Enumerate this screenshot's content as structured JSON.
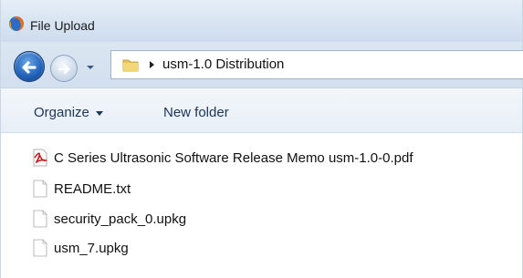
{
  "window": {
    "title": "File Upload"
  },
  "address": {
    "path_label": "usm-1.0 Distribution"
  },
  "toolbar": {
    "organize_label": "Organize",
    "new_folder_label": "New folder"
  },
  "files": [
    {
      "name": "C Series Ultrasonic Software Release Memo usm-1.0-0.pdf",
      "icon": "pdf-file-icon"
    },
    {
      "name": "README.txt",
      "icon": "text-file-icon"
    },
    {
      "name": "security_pack_0.upkg",
      "icon": "generic-file-icon"
    },
    {
      "name": "usm_7.upkg",
      "icon": "generic-file-icon"
    }
  ],
  "colors": {
    "accent_blue": "#1f5fb6",
    "command_text": "#1b3556",
    "pdf_red": "#c41e1e"
  }
}
